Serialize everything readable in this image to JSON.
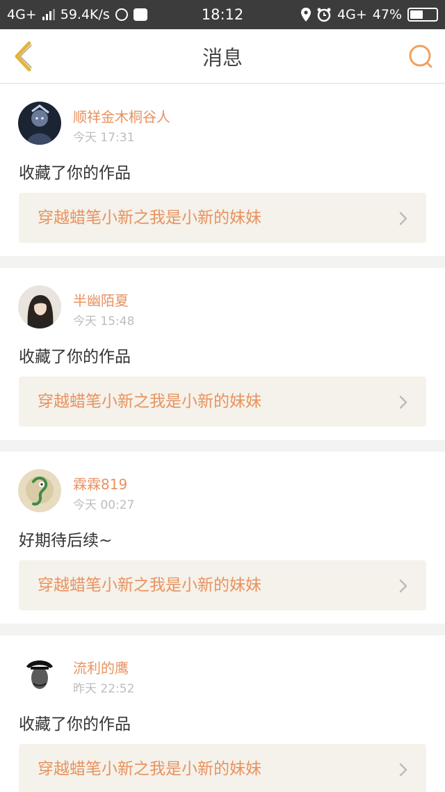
{
  "status_bar": {
    "network": "4G+",
    "speed": "59.4K/s",
    "time": "18:12",
    "network_right": "4G+",
    "battery": "47%"
  },
  "header": {
    "title": "消息",
    "accent_color": "#e89260"
  },
  "messages": [
    {
      "username": "顺祥金木桐谷人",
      "time": "今天 17:31",
      "text": "收藏了你的作品",
      "work_title": "穿越蜡笔小新之我是小新的妹妹",
      "avatar_icon": "avatar-anime-character"
    },
    {
      "username": "半幽陌夏",
      "time": "今天 15:48",
      "text": "收藏了你的作品",
      "work_title": "穿越蜡笔小新之我是小新的妹妹",
      "avatar_icon": "avatar-girl-portrait"
    },
    {
      "username": "霖霖819",
      "time": "今天 00:27",
      "text": "好期待后续~",
      "work_title": "穿越蜡笔小新之我是小新的妹妹",
      "avatar_icon": "avatar-green-cartoon"
    },
    {
      "username": "流利的鹰",
      "time": "昨天 22:52",
      "text": "收藏了你的作品",
      "work_title": "穿越蜡笔小新之我是小新的妹妹",
      "avatar_icon": "avatar-man-cap"
    }
  ]
}
